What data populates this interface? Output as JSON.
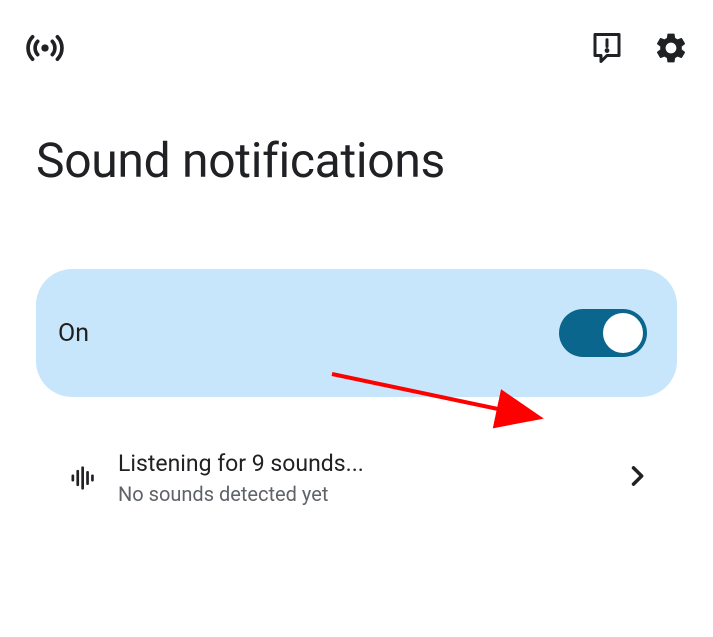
{
  "header": {
    "broadcast_icon": "broadcast-icon",
    "feedback_icon": "feedback-icon",
    "settings_icon": "gear-icon"
  },
  "page": {
    "title": "Sound notifications"
  },
  "toggle": {
    "label": "On",
    "state": "on",
    "switch_bg": "#0b668e",
    "card_bg": "#c7e6fb"
  },
  "listening_item": {
    "title": "Listening for 9 sounds...",
    "subtitle": "No sounds detected yet"
  },
  "annotation": {
    "type": "arrow",
    "color": "#ff0000",
    "points_to": "toggle-switch"
  }
}
